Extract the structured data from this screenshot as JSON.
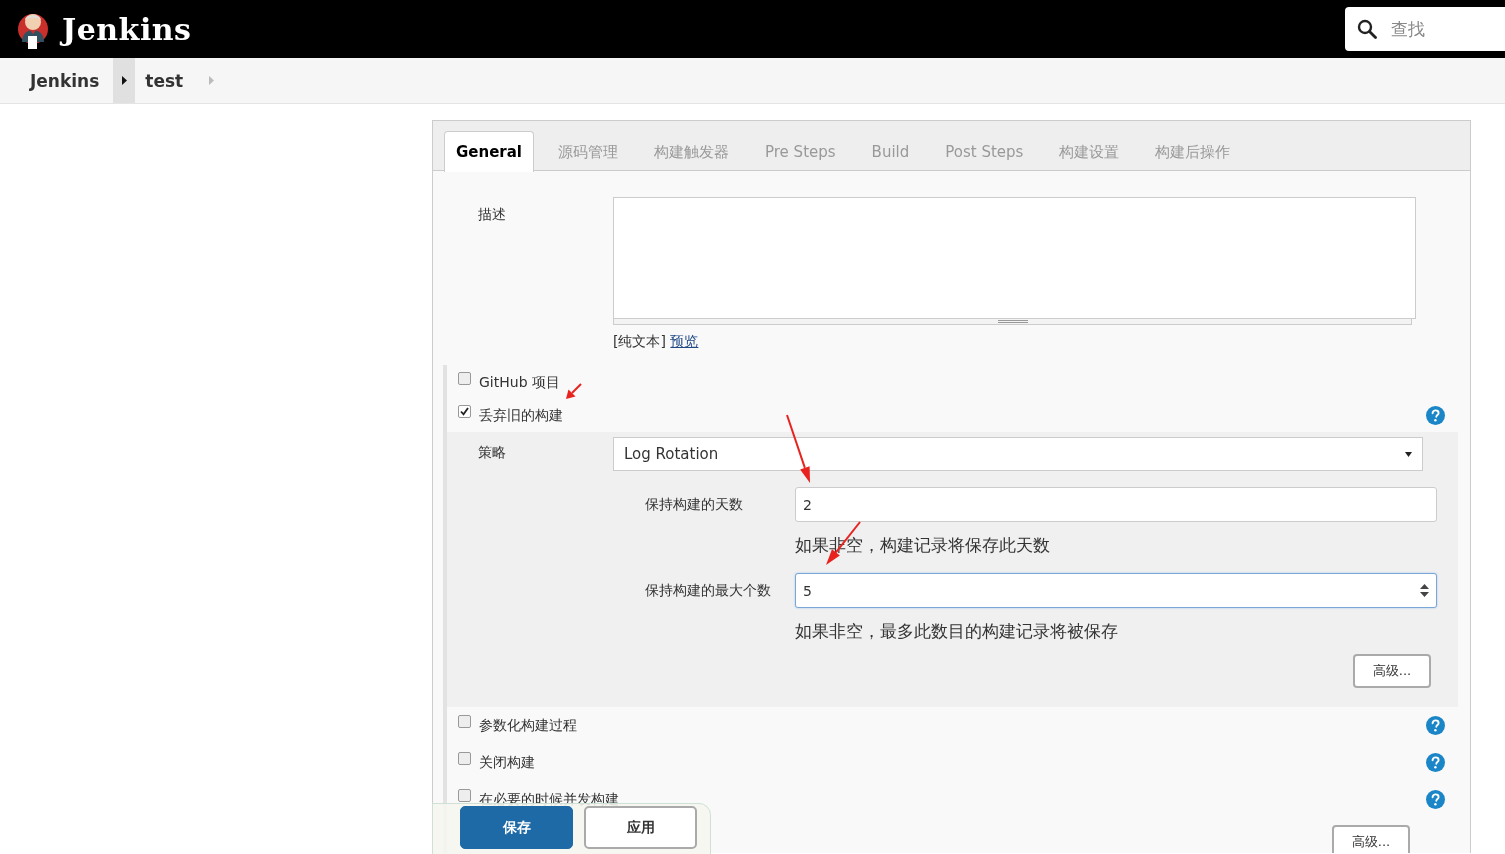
{
  "header": {
    "title": "Jenkins",
    "search": {
      "placeholder": "查找"
    }
  },
  "breadcrumbs": [
    "Jenkins",
    "test"
  ],
  "tabs": [
    {
      "label": "General",
      "selected": true
    },
    {
      "label": "源码管理",
      "selected": false
    },
    {
      "label": "构建触发器",
      "selected": false
    },
    {
      "label": "Pre Steps",
      "selected": false
    },
    {
      "label": "Build",
      "selected": false
    },
    {
      "label": "Post Steps",
      "selected": false
    },
    {
      "label": "构建设置",
      "selected": false
    },
    {
      "label": "构建后操作",
      "selected": false
    }
  ],
  "description": {
    "label": "描述",
    "format_note": "[纯文本]",
    "preview_link": "预览"
  },
  "options": [
    {
      "label": "GitHub 项目",
      "checked": false,
      "help": false
    },
    {
      "label": "丢弃旧的构建",
      "checked": true,
      "help": true,
      "settings": {
        "strategy_label": "策略",
        "strategy": "Log Rotation",
        "fields": [
          {
            "label": "保持构建的天数",
            "value": "2",
            "hint": "如果非空，构建记录将保存此天数",
            "focused": false
          },
          {
            "label": "保持构建的最大个数",
            "value": "5",
            "hint": "如果非空，最多此数目的构建记录将被保存",
            "focused": true
          }
        ],
        "advanced_button": "高级..."
      }
    },
    {
      "label": "参数化构建过程",
      "checked": false,
      "help": true
    },
    {
      "label": "关闭构建",
      "checked": false,
      "help": true
    },
    {
      "label": "在必要的时候并发构建",
      "checked": false,
      "help": true
    }
  ],
  "advanced_button": "高级...",
  "actions": [
    {
      "label": "保存",
      "kind": "primary"
    },
    {
      "label": "应用",
      "kind": "secondary"
    }
  ]
}
